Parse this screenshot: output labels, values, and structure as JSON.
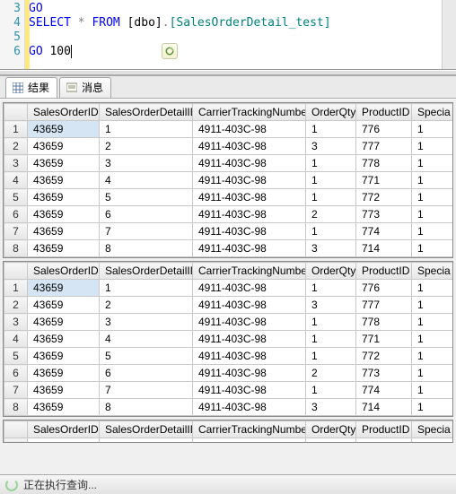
{
  "editor": {
    "lines": [
      {
        "num": "3",
        "tokens": [
          {
            "t": "GO",
            "c": "kw-blue"
          }
        ]
      },
      {
        "num": "4",
        "tokens": [
          {
            "t": "SELECT",
            "c": "kw-blue"
          },
          {
            "t": " "
          },
          {
            "t": "*",
            "c": "star-gray"
          },
          {
            "t": " "
          },
          {
            "t": "FROM",
            "c": "kw-blue"
          },
          {
            "t": " [dbo]"
          },
          {
            "t": ".",
            "c": "kw-gray"
          },
          {
            "t": "[SalesOrderDetail_test]",
            "c": "ident-green"
          }
        ]
      },
      {
        "num": "5",
        "tokens": []
      },
      {
        "num": "6",
        "tokens": [
          {
            "t": "GO",
            "c": "kw-blue"
          },
          {
            "t": " 100",
            "cursor": true
          }
        ]
      }
    ]
  },
  "tabs": {
    "results_label": "结果",
    "messages_label": "消息"
  },
  "columns": [
    "SalesOrderID",
    "SalesOrderDetailID",
    "CarrierTrackingNumber",
    "OrderQty",
    "ProductID",
    "Specia"
  ],
  "rows": [
    {
      "n": "1",
      "SalesOrderID": "43659",
      "SalesOrderDetailID": "1",
      "CarrierTrackingNumber": "4911-403C-98",
      "OrderQty": "1",
      "ProductID": "776",
      "Specia": "1"
    },
    {
      "n": "2",
      "SalesOrderID": "43659",
      "SalesOrderDetailID": "2",
      "CarrierTrackingNumber": "4911-403C-98",
      "OrderQty": "3",
      "ProductID": "777",
      "Specia": "1"
    },
    {
      "n": "3",
      "SalesOrderID": "43659",
      "SalesOrderDetailID": "3",
      "CarrierTrackingNumber": "4911-403C-98",
      "OrderQty": "1",
      "ProductID": "778",
      "Specia": "1"
    },
    {
      "n": "4",
      "SalesOrderID": "43659",
      "SalesOrderDetailID": "4",
      "CarrierTrackingNumber": "4911-403C-98",
      "OrderQty": "1",
      "ProductID": "771",
      "Specia": "1"
    },
    {
      "n": "5",
      "SalesOrderID": "43659",
      "SalesOrderDetailID": "5",
      "CarrierTrackingNumber": "4911-403C-98",
      "OrderQty": "1",
      "ProductID": "772",
      "Specia": "1"
    },
    {
      "n": "6",
      "SalesOrderID": "43659",
      "SalesOrderDetailID": "6",
      "CarrierTrackingNumber": "4911-403C-98",
      "OrderQty": "2",
      "ProductID": "773",
      "Specia": "1"
    },
    {
      "n": "7",
      "SalesOrderID": "43659",
      "SalesOrderDetailID": "7",
      "CarrierTrackingNumber": "4911-403C-98",
      "OrderQty": "1",
      "ProductID": "774",
      "Specia": "1"
    },
    {
      "n": "8",
      "SalesOrderID": "43659",
      "SalesOrderDetailID": "8",
      "CarrierTrackingNumber": "4911-403C-98",
      "OrderQty": "3",
      "ProductID": "714",
      "Specia": "1"
    }
  ],
  "status": {
    "text": "正在执行查询..."
  }
}
